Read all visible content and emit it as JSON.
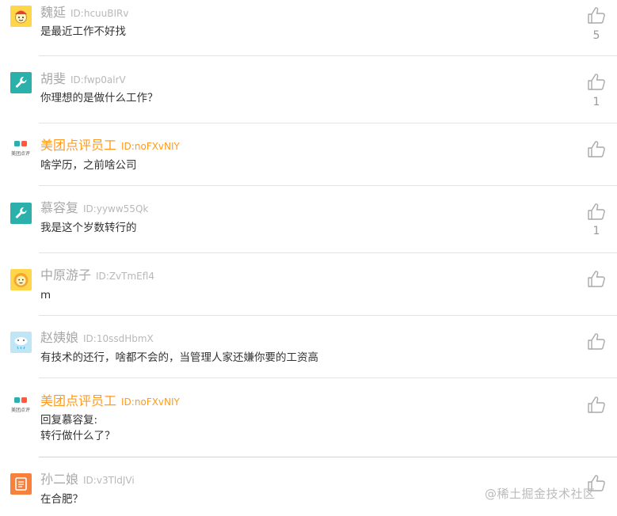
{
  "comments": [
    {
      "name": "魏延",
      "id_label": "ID:hcuuBIRv",
      "lines": [
        "是最近工作不好找"
      ],
      "likes": "5",
      "avatar": "yellow-face-avatar"
    },
    {
      "name": "胡斐",
      "id_label": "ID:fwp0alrV",
      "lines": [
        "你理想的是做什么工作？"
      ],
      "likes": "1",
      "avatar": "teal-wrench-avatar"
    },
    {
      "name": "美团点评员工",
      "id_label": "ID:noFXvNIY",
      "lines": [
        "啥学历，之前啥公司"
      ],
      "likes": "",
      "avatar": "meituan-logo-avatar"
    },
    {
      "name": "慕容复",
      "id_label": "ID:yyww55Qk",
      "lines": [
        "我是这个岁数转行的"
      ],
      "likes": "1",
      "avatar": "teal-wrench-avatar"
    },
    {
      "name": "中原游子",
      "id_label": "ID:ZvTmEfl4",
      "lines": [
        "m"
      ],
      "likes": "",
      "avatar": "yellow-lion-avatar"
    },
    {
      "name": "赵姨娘",
      "id_label": "ID:10ssdHbmX",
      "lines": [
        "有技术的还行，啥都不会的，当管理人家还嫌你要的工资高"
      ],
      "likes": "",
      "avatar": "blue-cloud-avatar"
    },
    {
      "name": "美团点评员工",
      "id_label": "ID:noFXvNIY",
      "lines": [
        "回复慕容复:",
        "转行做什么了？"
      ],
      "likes": "",
      "avatar": "meituan-logo-avatar"
    },
    {
      "name": "孙二娘",
      "id_label": "ID:v3TldJVi",
      "lines": [
        "在合肥？"
      ],
      "likes": "",
      "avatar": "orange-doc-avatar"
    }
  ],
  "logo_text": "美团点评",
  "watermark": "@稀土掘金技术社区",
  "colors": {
    "teal": "#2bb0ac",
    "orange": "#ff9a1f",
    "yellow": "#ffd54a",
    "light_blue": "#bfe6f7",
    "orange_doc": "#f5813c"
  }
}
